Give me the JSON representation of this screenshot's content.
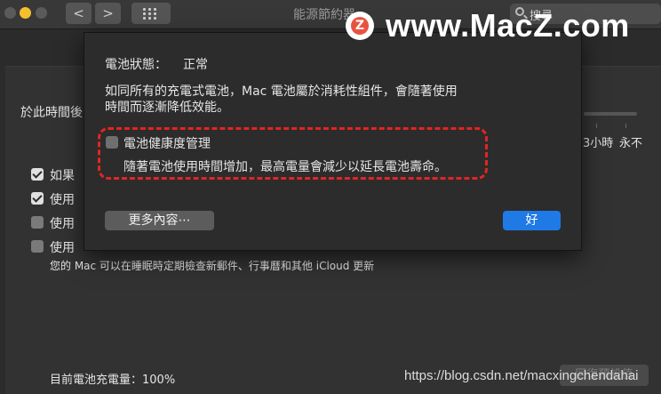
{
  "window": {
    "title": "能源節約器",
    "search_placeholder": "搜尋"
  },
  "nav": {
    "back_glyph": "<",
    "forward_glyph": ">"
  },
  "watermark": {
    "logo_letter": "Z",
    "text": "www.MacZ.com",
    "url": "https://blog.csdn.net/macxingchendahai"
  },
  "background_panel": {
    "section_label": "於此時間後",
    "slider_labels": [
      "3小時",
      "永不"
    ],
    "options": [
      {
        "label": "如果",
        "checked": true
      },
      {
        "label": "使用",
        "checked": true
      },
      {
        "label": "使用",
        "checked": false
      },
      {
        "label": "使用",
        "checked": false
      }
    ],
    "power_nap_text": "您的 Mac 可以在睡眠時定期檢查新郵件、行事曆和其他 iCloud 更新",
    "battery_charge": "目前電池充電量：100%",
    "faded_button": "回復預設值"
  },
  "dialog": {
    "status_label": "電池狀態：",
    "status_value": "正常",
    "description_line1": "如同所有的充電式電池，Mac 電池屬於消耗性組件，會隨著使用",
    "description_line2": "時間而逐漸降低效能。",
    "health_management_label": "電池健康度管理",
    "health_management_checked": false,
    "health_management_desc": "隨著電池使用時間增加，最高電量會減少以延長電池壽命。",
    "more_button": "更多內容⋯",
    "ok_button": "好"
  },
  "colors": {
    "accent": "#1f7ae6",
    "highlight": "#e32424",
    "watermark_logo": "#e8533f"
  }
}
